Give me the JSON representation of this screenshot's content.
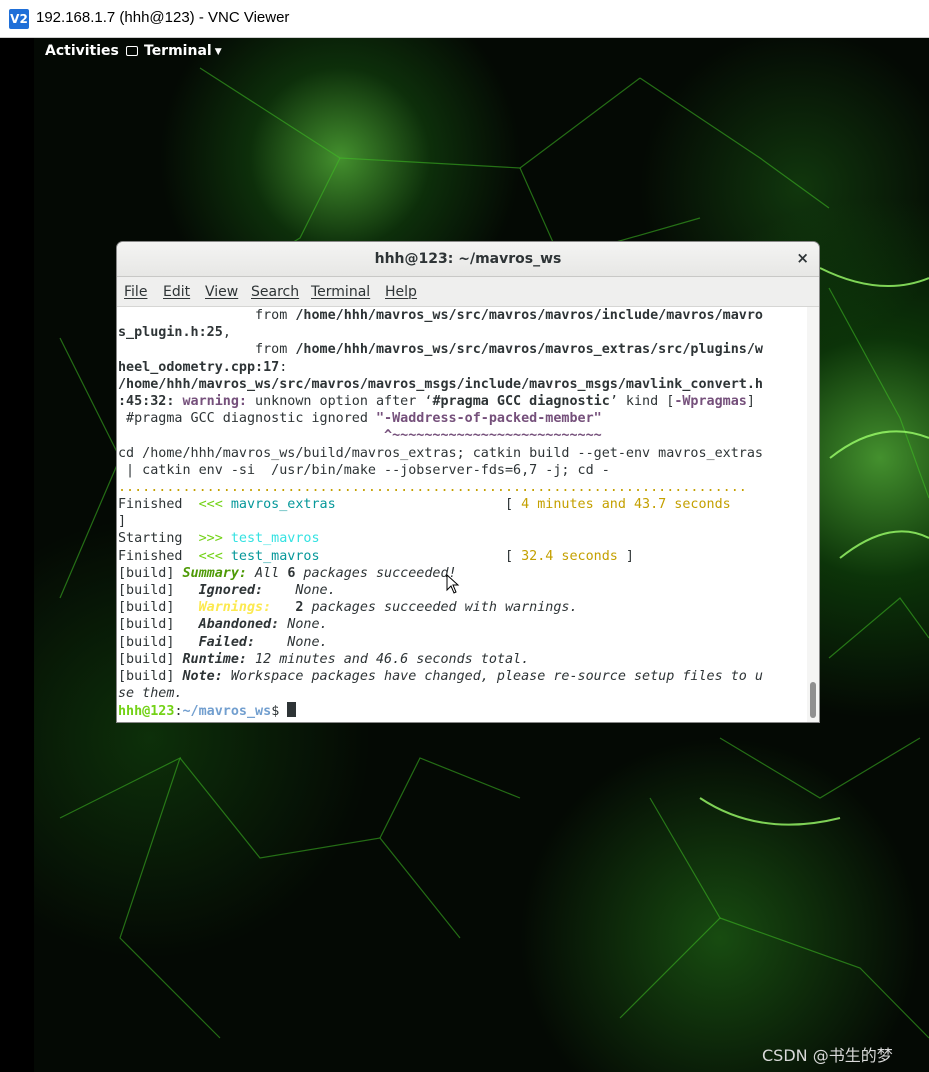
{
  "vnc": {
    "logo": "V2",
    "title": "192.168.1.7 (hhh@123) - VNC Viewer"
  },
  "gnome": {
    "activities": "Activities",
    "app_menu": "Terminal"
  },
  "terminal": {
    "window_title": "hhh@123: ~/mavros_ws",
    "close_glyph": "×",
    "menu": [
      "File",
      "Edit",
      "View",
      "Search",
      "Terminal",
      "Help"
    ],
    "prompt_user": "hhh@123",
    "prompt_sep": ":",
    "prompt_path": "~/mavros_ws",
    "prompt_dollar": "$ ",
    "lines": [
      [
        {
          "t": "                 from "
        },
        {
          "t": "/home/hhh/mavros_ws/src/mavros/mavros/include/mavros/mavro",
          "c": "b"
        }
      ],
      [
        {
          "t": "s_plugin.h:25",
          "c": "b"
        },
        {
          "t": ","
        }
      ],
      [
        {
          "t": "                 from "
        },
        {
          "t": "/home/hhh/mavros_ws/src/mavros/mavros_extras/src/plugins/w",
          "c": "b"
        }
      ],
      [
        {
          "t": "heel_odometry.cpp:17",
          "c": "b"
        },
        {
          "t": ":"
        }
      ],
      [
        {
          "t": "/home/hhh/mavros_ws/src/mavros/mavros_msgs/include/mavros_msgs/mavlink_convert.h",
          "c": "b"
        }
      ],
      [
        {
          "t": ":45:32:",
          "c": "b"
        },
        {
          "t": " "
        },
        {
          "t": "warning:",
          "c": "magenta"
        },
        {
          "t": " unknown option after ‘"
        },
        {
          "t": "#pragma GCC diagnostic",
          "c": "b"
        },
        {
          "t": "’ kind ["
        },
        {
          "t": "-Wpragmas",
          "c": "magenta"
        },
        {
          "t": "]"
        }
      ],
      [
        {
          "t": " #pragma GCC diagnostic ignored "
        },
        {
          "t": "\"-Waddress-of-packed-member\"",
          "c": "magenta"
        }
      ],
      [
        {
          "t": "                                 ^~~~~~~~~~~~~~~~~~~~~~~~~~~",
          "c": "magenta"
        }
      ],
      [
        {
          "t": "cd /home/hhh/mavros_ws/build/mavros_extras; catkin build --get-env mavros_extras"
        }
      ],
      [
        {
          "t": " | catkin env -si  /usr/bin/make --jobserver-fds=6,7 -j; cd -"
        }
      ],
      [
        {
          "t": "..............................................................................",
          "c": "yellow"
        }
      ],
      [
        {
          "t": "Finished  "
        },
        {
          "t": "<<<",
          "c": "green"
        },
        {
          "t": " "
        },
        {
          "t": "mavros_extras",
          "c": "cyan"
        },
        {
          "t": "                     [ "
        },
        {
          "t": "4 minutes and 43.7 seconds",
          "c": "yellow"
        }
      ],
      [
        {
          "t": "]"
        }
      ],
      [
        {
          "t": "Starting  "
        },
        {
          "t": ">>>",
          "c": "green"
        },
        {
          "t": " "
        },
        {
          "t": "test_mavros",
          "c": "cyanb"
        }
      ],
      [
        {
          "t": "Finished  "
        },
        {
          "t": "<<<",
          "c": "green"
        },
        {
          "t": " "
        },
        {
          "t": "test_mavros",
          "c": "cyan"
        },
        {
          "t": "                       [ "
        },
        {
          "t": "32.4 seconds",
          "c": "yellow"
        },
        {
          "t": " ]"
        }
      ],
      [
        {
          "t": "[build] "
        },
        {
          "t": "Summary:",
          "c": "green2 i"
        },
        {
          "t": " All ",
          "c": "i"
        },
        {
          "t": "6",
          "c": "b"
        },
        {
          "t": " packages succeeded!",
          "c": "i"
        }
      ],
      [
        {
          "t": "[build]   "
        },
        {
          "t": "Ignored:",
          "c": "b i"
        },
        {
          "t": "    None.",
          "c": "i"
        }
      ],
      [
        {
          "t": "[build]   "
        },
        {
          "t": "Warnings:",
          "c": "yellowb"
        },
        {
          "t": "   "
        },
        {
          "t": "2",
          "c": "b"
        },
        {
          "t": " packages succeeded with warnings.",
          "c": "i"
        }
      ],
      [
        {
          "t": "[build]   "
        },
        {
          "t": "Abandoned:",
          "c": "b i"
        },
        {
          "t": " None.",
          "c": "i"
        }
      ],
      [
        {
          "t": "[build]   "
        },
        {
          "t": "Failed:",
          "c": "b i"
        },
        {
          "t": "    None.",
          "c": "i"
        }
      ],
      [
        {
          "t": "[build] "
        },
        {
          "t": "Runtime:",
          "c": "b i"
        },
        {
          "t": " 12 minutes and 46.6 seconds total.",
          "c": "i"
        }
      ],
      [
        {
          "t": "[build] "
        },
        {
          "t": "Note:",
          "c": "b i"
        },
        {
          "t": " Workspace packages have changed, please re-source setup files to u",
          "c": "i"
        }
      ],
      [
        {
          "t": "se them.",
          "c": "i"
        }
      ]
    ]
  },
  "watermark": "CSDN @书生的梦",
  "colors": {
    "terminal_bg": "#ffffff",
    "prompt_user": "#73d216",
    "prompt_path": "#729fcf",
    "warning": "#75507b",
    "yellow": "#c4a000",
    "cyan": "#06989a"
  },
  "icons": [
    "vnc-logo-icon",
    "terminal-app-icon",
    "chevron-down-icon",
    "close-icon",
    "mouse-pointer-icon"
  ]
}
